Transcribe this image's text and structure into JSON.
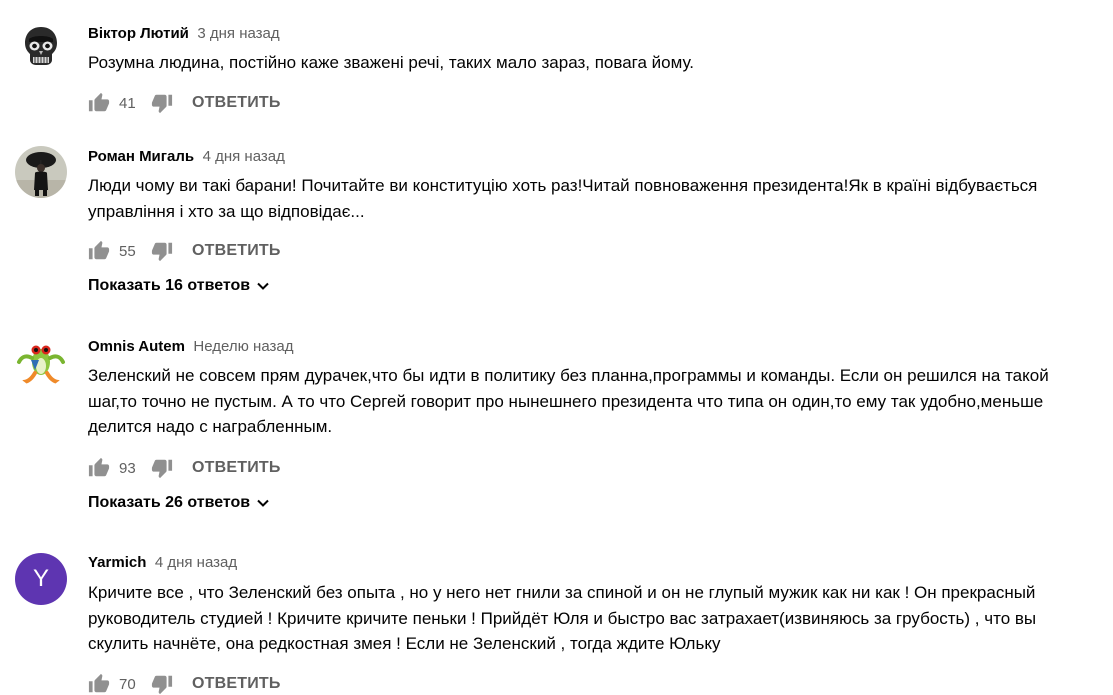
{
  "comments": [
    {
      "author": "Віктор Лютий",
      "time": "3 дня назад",
      "text": "Розумна людина, постійно каже зважені речі, таких мало зараз, повага йому.",
      "likes": "41",
      "reply_label": "ОТВЕТИТЬ",
      "avatar_icon": "skull-icon"
    },
    {
      "author": "Роман Мигаль",
      "time": "4 дня назад",
      "text": "Люди чому ви такі барани! Почитайте ви конституцію хоть раз!Читай повноваження президента!Як в країні відбувається управління і хто за що відповідає...",
      "likes": "55",
      "reply_label": "ОТВЕТИТЬ",
      "show_replies": "Показать 16 ответов",
      "avatar_icon": "person-umbrella-icon"
    },
    {
      "author": "Omnis Autem",
      "time": "Неделю назад",
      "text": "Зеленский не совсем прям дурачек,что бы идти в политику без планна,программы и команды.  Если он решился на такой шаг,то точно не пустым.  А  то что Сергей говорит про нынешнего президента что типа он один,то ему так удобно,меньше делится надо с награбленным.",
      "likes": "93",
      "reply_label": "ОТВЕТИТЬ",
      "show_replies": "Показать 26 ответов",
      "avatar_icon": "frog-icon"
    },
    {
      "author": "Yarmich",
      "time": "4 дня назад",
      "text": "Кричите все , что Зеленский без опыта , но у него нет гнили за спиной и он не глупый мужик как ни как ! Он прекрасный руководитель студией ! Кричите кричите пеньки ! Прийдёт Юля и быстро вас затрахает(извиняюсь за грубость) , что вы скулить начнёте, она редкостная змея ! Если не Зеленский , тогда ждите Юльку",
      "likes": "70",
      "reply_label": "ОТВЕТИТЬ",
      "avatar_letter": "Y",
      "avatar_color": "#5e35b1"
    }
  ],
  "colors": {
    "text": "#030303",
    "secondary": "#606060",
    "icon": "#909090"
  }
}
